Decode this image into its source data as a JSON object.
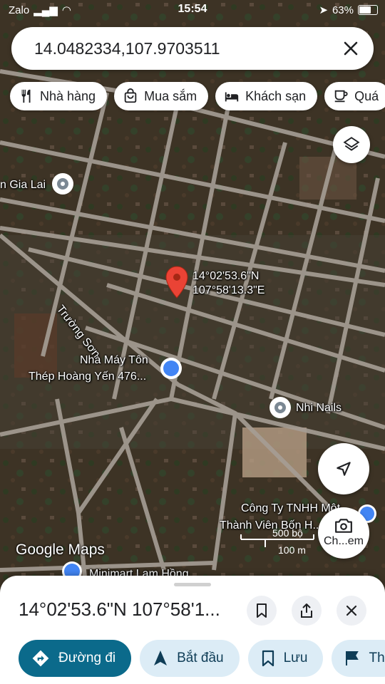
{
  "status_bar": {
    "carrier": "Zalo",
    "time": "15:54",
    "battery": "63%"
  },
  "search": {
    "query": "14.0482334,107.9703511"
  },
  "chips": [
    {
      "label": "Nhà hàng",
      "icon": "restaurant-icon"
    },
    {
      "label": "Mua sắm",
      "icon": "shopping-bag-icon"
    },
    {
      "label": "Khách sạn",
      "icon": "hotel-icon"
    },
    {
      "label": "Quá",
      "icon": "coffee-icon"
    }
  ],
  "map": {
    "marker_label_lat": "14°02'53.6\"N",
    "marker_label_lng": "107°58'13.3\"E",
    "places": {
      "gia_lai": "n Gia Lai",
      "factory_line1": "Nhà Máy Tôn",
      "factory_line2": "Thép Hoàng Yến 476...",
      "nails": "Nhi Nails",
      "company_line1": "Công Ty TNHH Một",
      "company_line2": "Thành Viên Bốn H...",
      "minimart": "Minimart Lam Hồng"
    },
    "road_label": "Trường Sơn",
    "branding": "Google Maps",
    "scale_feet": "500 bộ",
    "scale_meters": "100 m",
    "camera_label": "Ch...em"
  },
  "sheet": {
    "title": "14°02'53.6\"N 107°58'1...",
    "actions": {
      "directions": "Đường đi",
      "start": "Bắt đầu",
      "save": "Lưu",
      "more": "Th"
    }
  },
  "colors": {
    "accent": "#0b6a8b",
    "action_secondary_bg": "#dcecf6",
    "marker": "#ea4335"
  }
}
